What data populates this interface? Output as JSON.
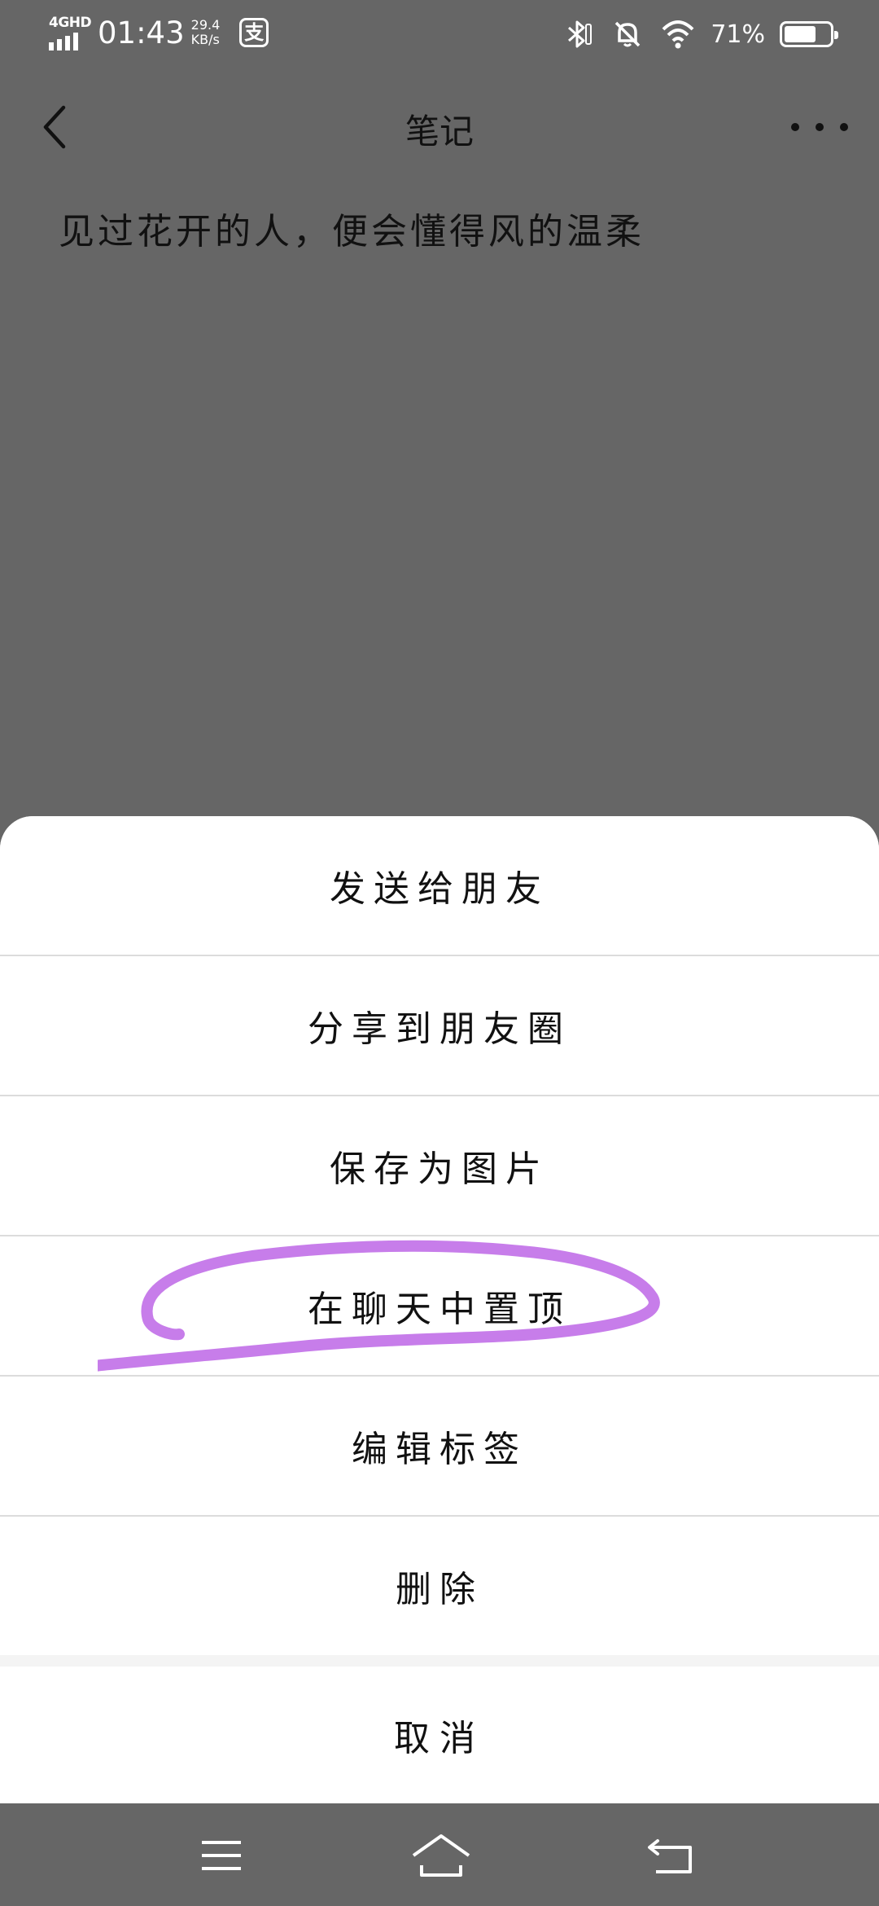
{
  "status_bar": {
    "network": "4GHD",
    "time": "01:43",
    "speed_value": "29.4",
    "speed_unit": "KB/s",
    "app_icon": "支",
    "battery_percent": "71%",
    "battery_level": 0.71
  },
  "header": {
    "title": "笔记",
    "back_icon": "chevron-left-icon",
    "more_icon": "more-horizontal-icon"
  },
  "note": {
    "text": "见过花开的人，便会懂得风的温柔"
  },
  "action_sheet": {
    "items": [
      {
        "label": "发送给朋友"
      },
      {
        "label": "分享到朋友圈"
      },
      {
        "label": "保存为图片"
      },
      {
        "label": "在聊天中置顶"
      },
      {
        "label": "编辑标签"
      },
      {
        "label": "删除"
      }
    ],
    "cancel_label": "取消",
    "highlight_color": "#c77dea"
  },
  "nav_bar": {
    "menu_icon": "menu-icon",
    "home_icon": "home-icon",
    "back_icon": "back-icon"
  }
}
